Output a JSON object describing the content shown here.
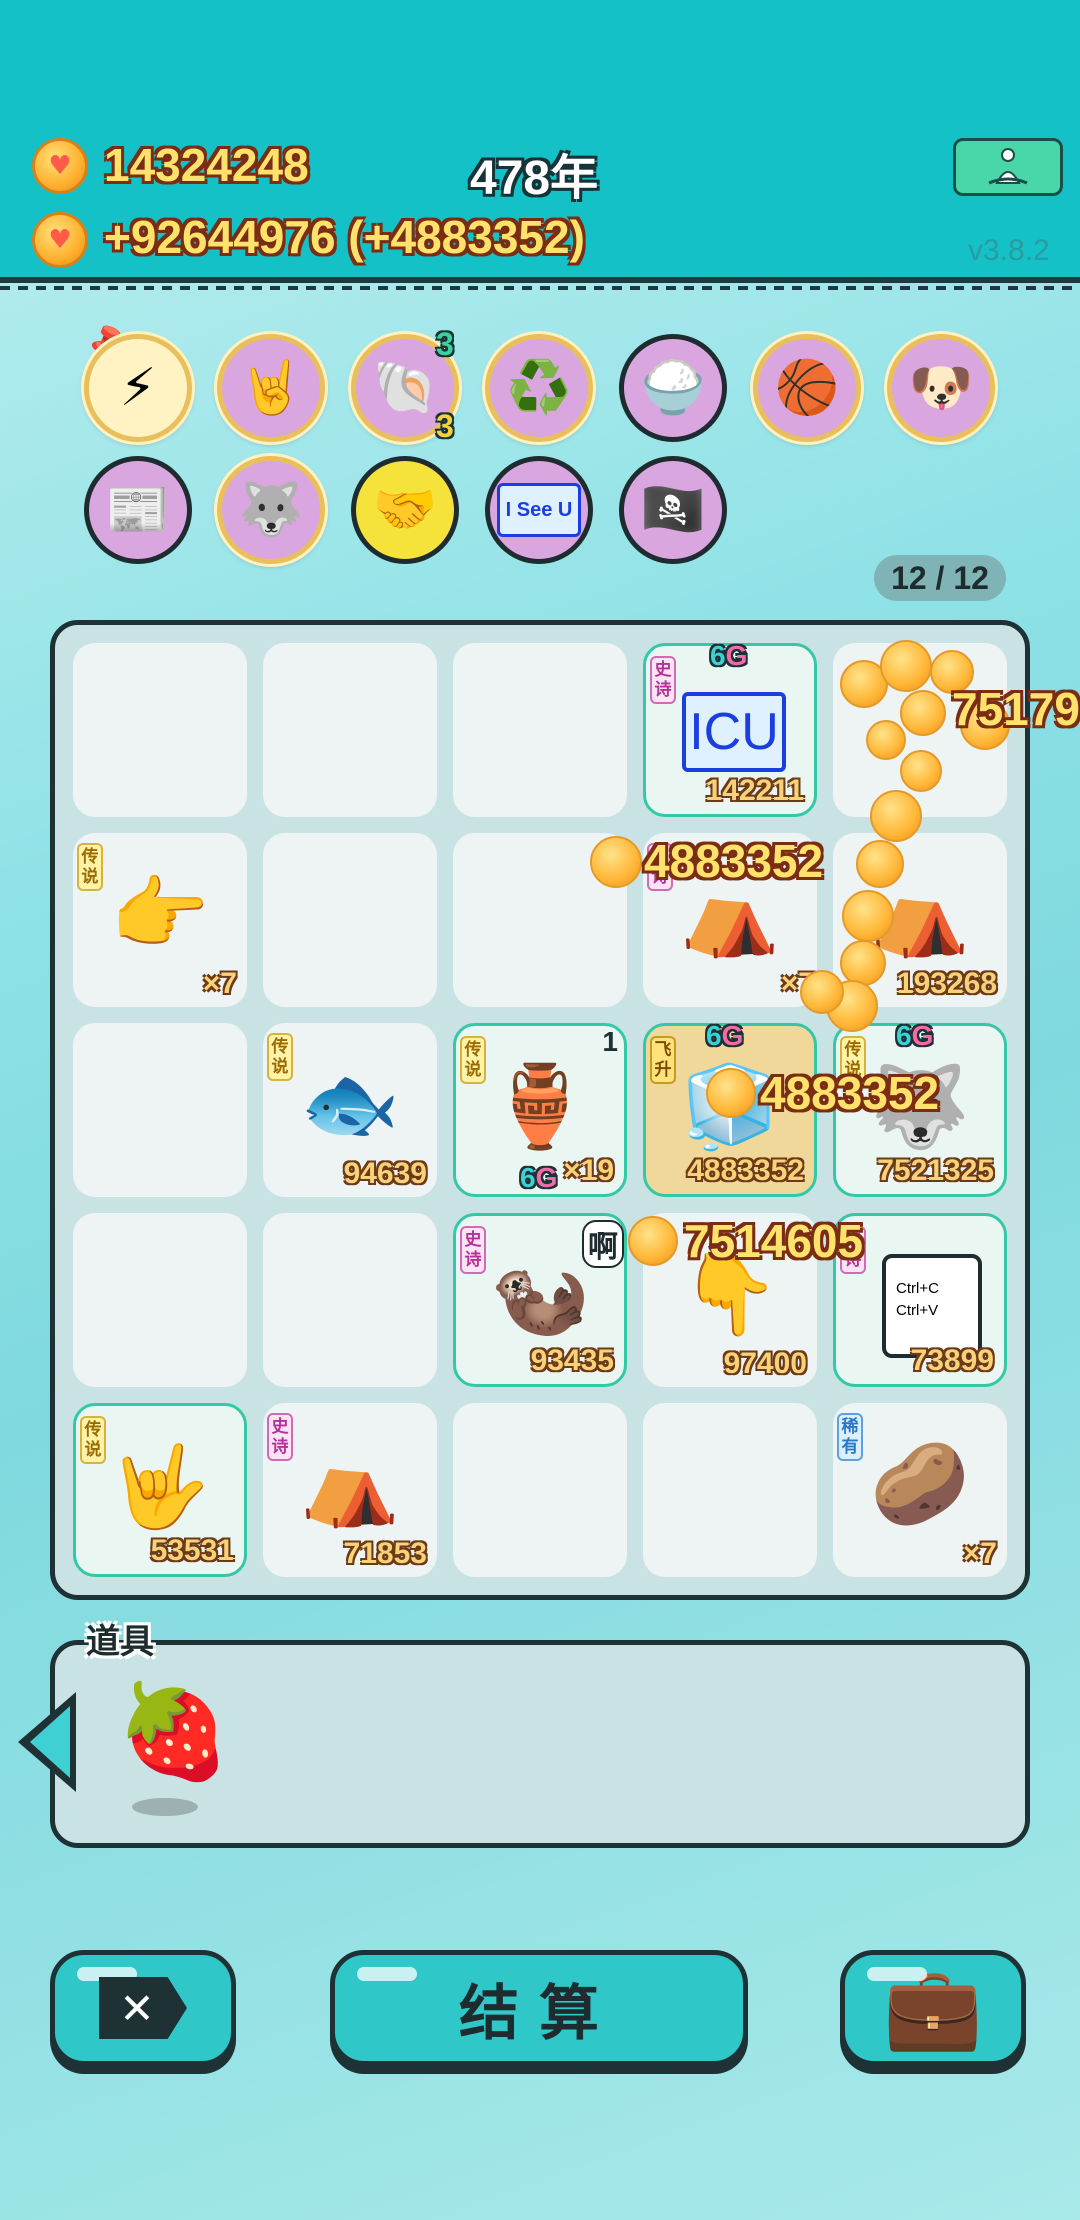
{
  "header": {
    "coins": "14324248",
    "income": "+92644976 (+4883352)",
    "year": "478年",
    "version": "v3.8.2"
  },
  "buffs": {
    "shell_count_top": "3",
    "shell_count_bottom": "3",
    "page_counter": "12 / 12"
  },
  "board": {
    "cells": [
      {
        "id": "icu",
        "tag": "史诗",
        "tier_a": "6",
        "tier_b": "G",
        "icon_text": "ICU",
        "value": "142211"
      },
      {
        "id": "hand-legend",
        "tag": "传说",
        "value": "×7"
      },
      {
        "id": "tent-epic",
        "tag": "史诗",
        "value": "×7"
      },
      {
        "id": "tent-2",
        "value": "193268"
      },
      {
        "id": "koi",
        "tag": "传说",
        "value": "94639"
      },
      {
        "id": "vase",
        "tag": "传说",
        "corner": "1",
        "value": "×19",
        "tier_a": "6",
        "tier_b": "G"
      },
      {
        "id": "fridge",
        "tag": "飞升",
        "tier_a": "6",
        "tier_b": "G",
        "value": "4883352"
      },
      {
        "id": "husky",
        "tag": "传说",
        "tier_a": "6",
        "tier_b": "G",
        "value": "7521325"
      },
      {
        "id": "meerkat",
        "tag": "史诗",
        "bubble": "啊",
        "value": "93435"
      },
      {
        "id": "pointer",
        "value": "97400"
      },
      {
        "id": "ctrl",
        "tag": "史诗",
        "line1": "Ctrl+C",
        "line2": "Ctrl+V",
        "value": "73899"
      },
      {
        "id": "rock-hand",
        "tag": "传说",
        "value": "53531"
      },
      {
        "id": "tent-3",
        "tag": "史诗",
        "value": "71853"
      },
      {
        "id": "potato",
        "tag": "稀有",
        "value": "×7"
      }
    ],
    "floating": [
      "75179",
      "4883352",
      "4883352",
      "7514605"
    ]
  },
  "items": {
    "label": "道具",
    "strawberry_icon": "strawberry-icon"
  },
  "buttons": {
    "settle_label": "结算",
    "close_icon": "close-icon",
    "bag_icon": "briefcase-icon"
  }
}
